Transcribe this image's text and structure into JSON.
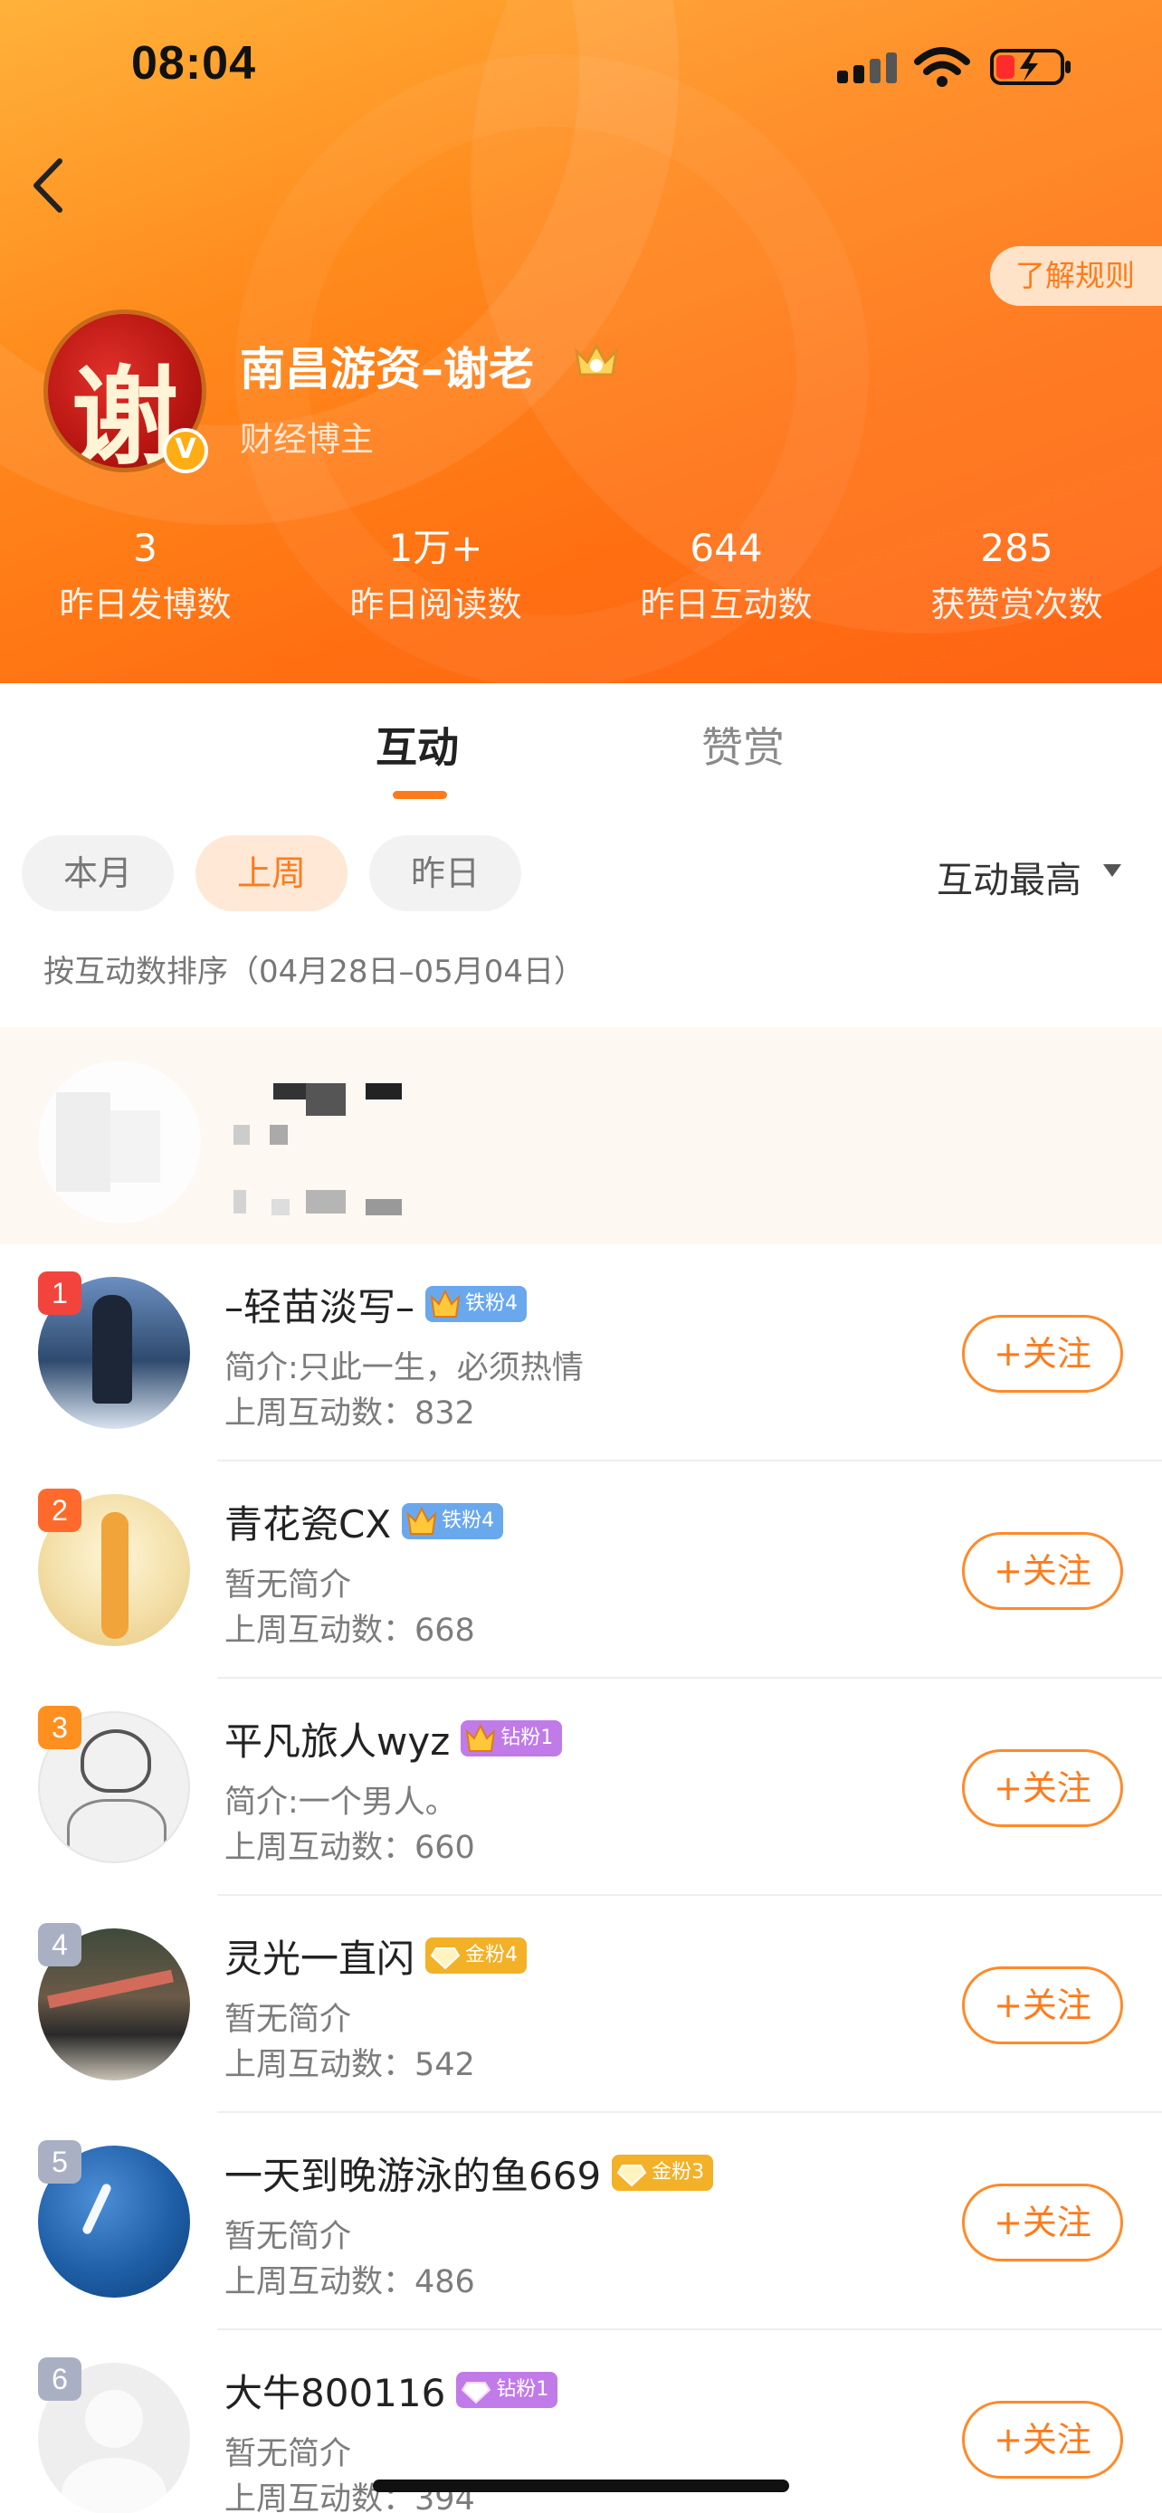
{
  "status_bar": {
    "time": "08:04"
  },
  "header": {
    "rules_label": "了解规则",
    "user_name": "南昌游资–谢老",
    "avatar_glyph": "谢",
    "verified_mark": "V",
    "user_role": "财经博主",
    "stats": [
      {
        "value": "3",
        "label": "昨日发博数"
      },
      {
        "value": "1万+",
        "label": "昨日阅读数"
      },
      {
        "value": "644",
        "label": "昨日互动数"
      },
      {
        "value": "285",
        "label": "获赞赏次数"
      }
    ]
  },
  "tabs": [
    {
      "label": "互动",
      "active": true
    },
    {
      "label": "赞赏",
      "active": false
    }
  ],
  "filters": [
    {
      "label": "本月",
      "active": false
    },
    {
      "label": "上周",
      "active": true
    },
    {
      "label": "昨日",
      "active": false
    }
  ],
  "sort": {
    "selected": "互动最高",
    "note": "按互动数排序（04月28日–05月04日）"
  },
  "list": [
    {
      "rank": "1",
      "name": "–轻苗淡写–",
      "badge": "铁粉4",
      "badge_type": "tie",
      "bio": "简介:只此一生，必须热情",
      "count": "上周互动数：832",
      "follow": "+关注"
    },
    {
      "rank": "2",
      "name": "青花瓷CX",
      "badge": "铁粉4",
      "badge_type": "tie",
      "bio": "暂无简介",
      "count": "上周互动数：668",
      "follow": "+关注"
    },
    {
      "rank": "3",
      "name": "平凡旅人wyz",
      "badge": "钻粉1",
      "badge_type": "zuan",
      "bio": "简介:一个男人。",
      "count": "上周互动数：660",
      "follow": "+关注"
    },
    {
      "rank": "4",
      "name": "灵光一直闪",
      "badge": "金粉4",
      "badge_type": "jin",
      "bio": "暂无简介",
      "count": "上周互动数：542",
      "follow": "+关注"
    },
    {
      "rank": "5",
      "name": "一天到晚游泳的鱼669",
      "badge": "金粉3",
      "badge_type": "jin",
      "bio": "暂无简介",
      "count": "上周互动数：486",
      "follow": "+关注"
    },
    {
      "rank": "6",
      "name": "大牛800116",
      "badge": "钻粉1",
      "badge_type": "zuan",
      "bio": "暂无简介",
      "count": "上周互动数：394",
      "follow": "+关注"
    }
  ],
  "colors": {
    "accent": "#ff7a1a",
    "header_gradient_start": "#ffb23a",
    "header_gradient_end": "#ff6414"
  },
  "icons": [
    "back-arrow-icon",
    "signal-icon",
    "wifi-icon",
    "battery-charging-icon",
    "crown-icon",
    "verified-v-icon",
    "dropdown-arrow-icon"
  ]
}
